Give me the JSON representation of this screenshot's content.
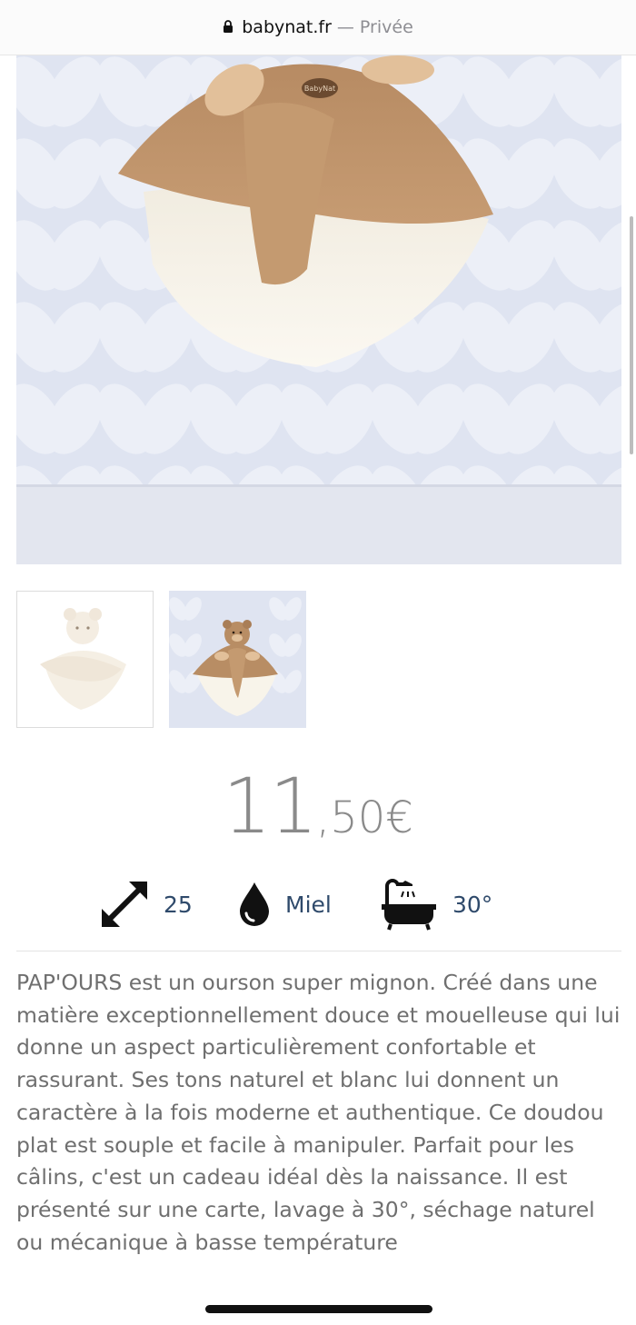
{
  "browser": {
    "domain": "babynat.fr",
    "separator": "—",
    "mode": "Privée"
  },
  "product": {
    "price_integer": "11",
    "price_decimal": ",50€",
    "attributes": [
      {
        "icon": "resize-arrows-icon",
        "value": "25"
      },
      {
        "icon": "drop-icon",
        "value": "Miel"
      },
      {
        "icon": "bathtub-icon",
        "value": "30°"
      }
    ],
    "description": "PAP'OURS est un ourson super mignon. Créé dans une matière exceptionnellement douce et mouelleuse qui lui donne un aspect particulièrement confortable et rassurant. Ses tons naturel et blanc lui donnent un caractère à la fois moderne et authentique. Ce doudou plat est souple et facile à manipuler. Parfait pour les câlins, c'est un cadeau idéal dès la naissance. Il est présenté sur une carte, lavage à 30°, séchage naturel ou mécanique à basse température",
    "badge_text": "BabyNat"
  },
  "colors": {
    "accent_text": "#2f4a6b",
    "price": "#8a8a8a",
    "body_text": "#6f6f6f"
  }
}
